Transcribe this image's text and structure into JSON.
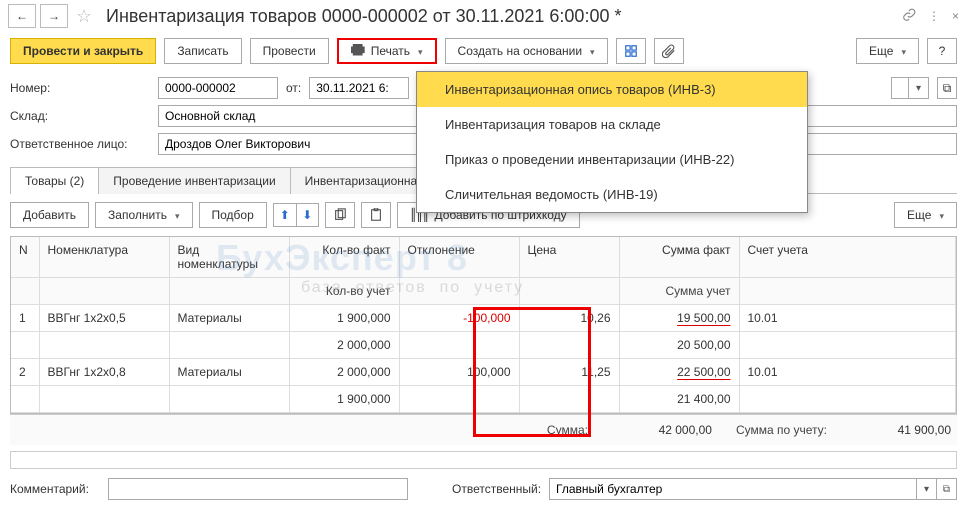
{
  "title": "Инвентаризация товаров 0000-000002 от 30.11.2021 6:00:00 *",
  "toolbar": {
    "post_close": "Провести и закрыть",
    "save": "Записать",
    "post": "Провести",
    "print": "Печать",
    "create_based": "Создать на основании",
    "more": "Еще",
    "help": "?"
  },
  "form": {
    "number_label": "Номер:",
    "number_value": "0000-000002",
    "date_from_label": "от:",
    "date_value": "30.11.2021 6:",
    "warehouse_label": "Склад:",
    "warehouse_value": "Основной склад",
    "responsible_label": "Ответственное лицо:",
    "responsible_value": "Дроздов Олег Викторович"
  },
  "tabs": {
    "t0": "Товары (2)",
    "t1": "Проведение инвентаризации",
    "t2": "Инвентаризационная комиссия"
  },
  "tabtoolbar": {
    "add": "Добавить",
    "fill": "Заполнить",
    "pick": "Подбор",
    "barcode": "Добавить по штрихкоду",
    "more": "Еще"
  },
  "columns": {
    "n": "N",
    "nom": "Номенклатура",
    "kind": "Вид номенклатуры",
    "qty_fact": "Кол-во факт",
    "qty_plan": "Кол-во учет",
    "diff": "Отклонение",
    "price": "Цена",
    "sum_fact": "Сумма факт",
    "sum_plan": "Сумма учет",
    "account": "Счет учета"
  },
  "rows": [
    {
      "n": "1",
      "nom": "ВВГнг 1х2х0,5",
      "kind": "Материалы",
      "qty_fact": "1 900,000",
      "qty_plan": "2 000,000",
      "diff": "-100,000",
      "price": "10,26",
      "sum_fact": "19 500,00",
      "sum_plan": "20 500,00",
      "account": "10.01"
    },
    {
      "n": "2",
      "nom": "ВВГнг 1х2х0,8",
      "kind": "Материалы",
      "qty_fact": "2 000,000",
      "qty_plan": "1 900,000",
      "diff": "100,000",
      "price": "11,25",
      "sum_fact": "22 500,00",
      "sum_plan": "21 400,00",
      "account": "10.01"
    }
  ],
  "totals": {
    "sum_label": "Сумма:",
    "sum_val": "42 000,00",
    "sum_plan_label": "Сумма по учету:",
    "sum_plan_val": "41 900,00"
  },
  "dropdown": {
    "i0": "Инвентаризационная опись товаров (ИНВ-3)",
    "i1": "Инвентаризация товаров на складе",
    "i2": "Приказ о проведении инвентаризации (ИНВ-22)",
    "i3": "Сличительная ведомость (ИНВ-19)"
  },
  "footer": {
    "comment_label": "Комментарий:",
    "resp_label": "Ответственный:",
    "resp_value": "Главный бухгалтер"
  },
  "chart_data": {
    "type": "table",
    "columns": [
      "N",
      "Номенклатура",
      "Вид номенклатуры",
      "Кол-во факт",
      "Кол-во учет",
      "Отклонение",
      "Цена",
      "Сумма факт",
      "Сумма учет",
      "Счет учета"
    ],
    "rows": [
      [
        1,
        "ВВГнг 1х2х0,5",
        "Материалы",
        1900.0,
        2000.0,
        -100.0,
        10.26,
        19500.0,
        20500.0,
        "10.01"
      ],
      [
        2,
        "ВВГнг 1х2х0,8",
        "Материалы",
        2000.0,
        1900.0,
        100.0,
        11.25,
        22500.0,
        21400.0,
        "10.01"
      ]
    ],
    "totals": {
      "sum_fact": 42000.0,
      "sum_plan": 41900.0
    }
  }
}
